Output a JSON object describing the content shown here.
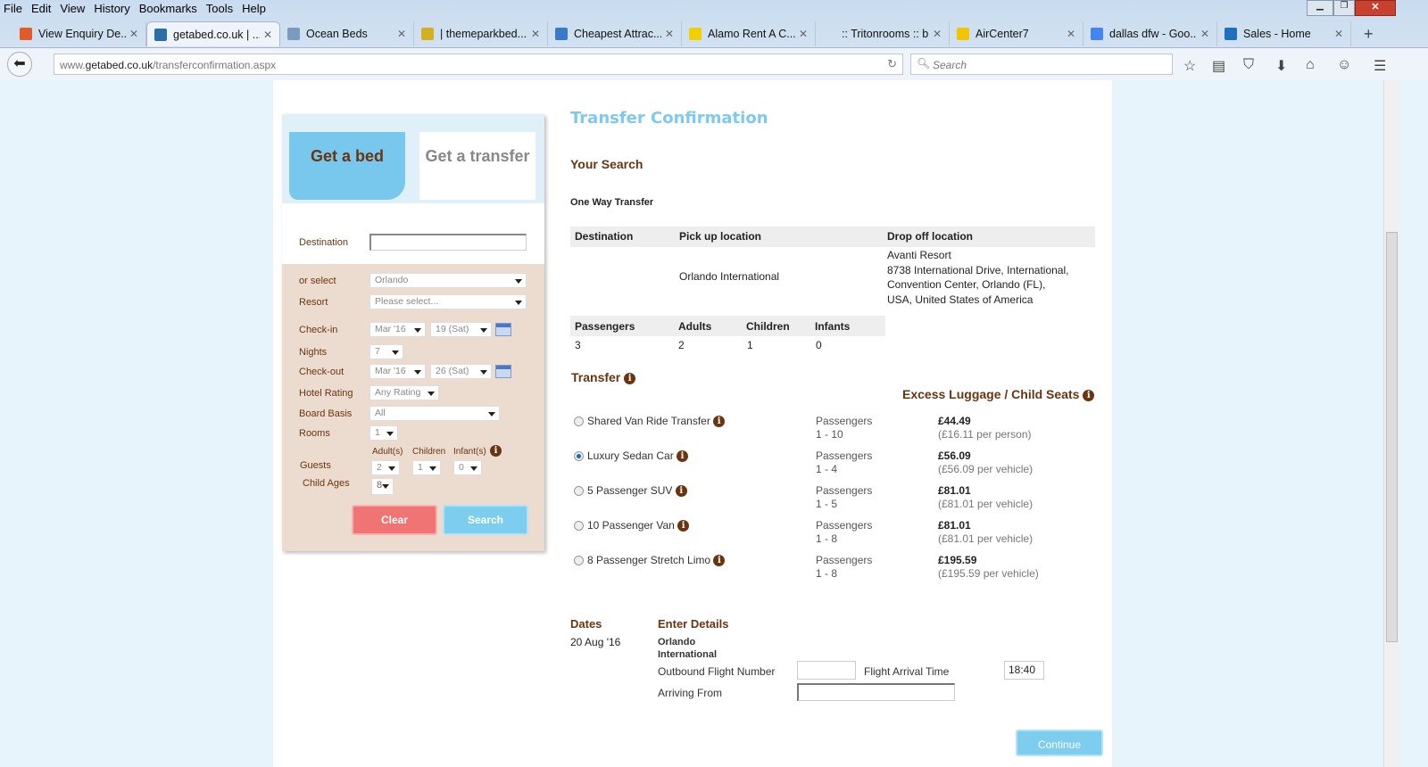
{
  "browser": {
    "menu": [
      "File",
      "Edit",
      "View",
      "History",
      "Bookmarks",
      "Tools",
      "Help"
    ],
    "tabs": [
      {
        "label": "View Enquiry De...",
        "color": "#e05a2a"
      },
      {
        "label": "getabed.co.uk | ...",
        "color": "#2a6fa8",
        "active": true
      },
      {
        "label": "Ocean Beds",
        "color": "#7a9ac0"
      },
      {
        "label": "| themeparkbed...",
        "color": "#d4b020"
      },
      {
        "label": "Cheapest Attrac...",
        "color": "#3a78c8"
      },
      {
        "label": "Alamo Rent A C...",
        "color": "#f0d000"
      },
      {
        "label": ":: Tritonrooms :: brin...",
        "color": "transparent"
      },
      {
        "label": "AirCenter7",
        "color": "#f5c400"
      },
      {
        "label": "dallas dfw - Goo...",
        "color": "#4285f4"
      },
      {
        "label": "Sales - Home",
        "color": "#1e6fc0"
      }
    ],
    "url_prefix": "www.",
    "url_domain": "getabed.co.uk",
    "url_path": "/transferconfirmation.aspx",
    "search_placeholder": "Search"
  },
  "sidebar": {
    "tab_bed": "Get a bed",
    "tab_transfer": "Get a transfer",
    "destination_label": "Destination",
    "or_select_label": "or select",
    "or_select_value": "Orlando",
    "resort_label": "Resort",
    "resort_value": "Please select...",
    "checkin_label": "Check-in",
    "checkin_month": "Mar '16",
    "checkin_day": "19 (Sat)",
    "nights_label": "Nights",
    "nights_value": "7",
    "checkout_label": "Check-out",
    "checkout_month": "Mar '16",
    "checkout_day": "26 (Sat)",
    "rating_label": "Hotel Rating",
    "rating_value": "Any Rating",
    "board_label": "Board Basis",
    "board_value": "All",
    "rooms_label": "Rooms",
    "rooms_value": "1",
    "adults_label": "Adult(s)",
    "children_label": "Children",
    "infants_label": "Infant(s)",
    "guests_label": "Guests",
    "adults_value": "2",
    "children_value": "1",
    "infants_value": "0",
    "child_ages_label": "Child Ages",
    "child_age_value": "8",
    "clear": "Clear",
    "search": "Search"
  },
  "main": {
    "title": "Transfer Confirmation",
    "your_search": "Your Search",
    "one_way": "One Way Transfer",
    "loc_headers": [
      "Destination",
      "Pick up location",
      "Drop off location"
    ],
    "pickup": "Orlando International",
    "dropoff": [
      "Avanti Resort",
      "8738 International Drive, International,",
      "Convention Center, Orlando (FL),",
      "USA, United States of America"
    ],
    "pax_headers": [
      "Passengers",
      "Adults",
      "Children",
      "Infants"
    ],
    "pax_values": [
      "3",
      "2",
      "1",
      "0"
    ],
    "transfer_heading": "Transfer",
    "excess_heading": "Excess Luggage / Child Seats",
    "options": [
      {
        "name": "Shared Van Ride Transfer",
        "pax_label": "Passengers",
        "pax": "1 - 10",
        "price": "£44.49",
        "detail": "(£16.11 per person)",
        "selected": false
      },
      {
        "name": "Luxury Sedan Car",
        "pax_label": "Passengers",
        "pax": "1 - 4",
        "price": "£56.09",
        "detail": "(£56.09 per vehicle)",
        "selected": true
      },
      {
        "name": "5 Passenger SUV",
        "pax_label": "Passengers",
        "pax": "1 - 5",
        "price": "£81.01",
        "detail": "(£81.01 per vehicle)",
        "selected": false
      },
      {
        "name": "10 Passenger Van",
        "pax_label": "Passengers",
        "pax": "1 - 8",
        "price": "£81.01",
        "detail": "(£81.01 per vehicle)",
        "selected": false
      },
      {
        "name": "8 Passenger Stretch Limo",
        "pax_label": "Passengers",
        "pax": "1 - 8",
        "price": "£195.59",
        "detail": "(£195.59 per vehicle)",
        "selected": false
      }
    ],
    "dates_heading": "Dates",
    "date_value": "20 Aug '16",
    "details_heading": "Enter Details",
    "airport_line1": "Orlando",
    "airport_line2": "International",
    "flight_number_label": "Outbound Flight Number",
    "arrival_time_label": "Flight Arrival Time",
    "arrival_time_value": "18:40",
    "arriving_from_label": "Arriving From",
    "continue": "Continue"
  }
}
